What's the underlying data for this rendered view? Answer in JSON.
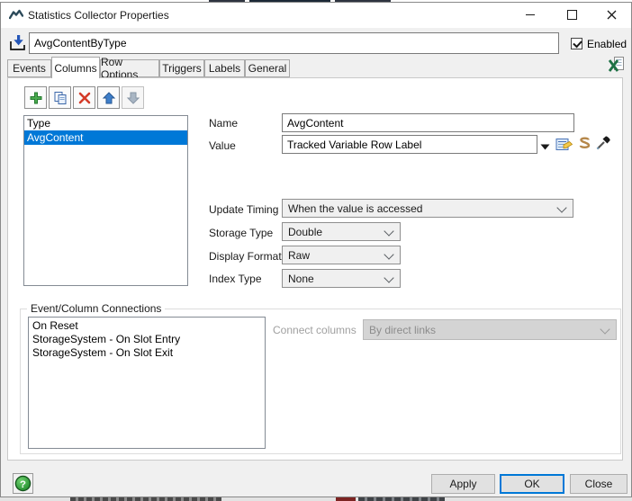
{
  "window": {
    "title": "Statistics Collector Properties",
    "controls": {
      "minimize": "minimize",
      "maximize": "maximize",
      "close": "close"
    }
  },
  "header": {
    "name_value": "AvgContentByType",
    "enabled_label": "Enabled"
  },
  "tabs": [
    {
      "label": "Events",
      "active": false
    },
    {
      "label": "Columns",
      "active": true
    },
    {
      "label": "Row Options",
      "active": false
    },
    {
      "label": "Triggers",
      "active": false
    },
    {
      "label": "Labels",
      "active": false
    },
    {
      "label": "General",
      "active": false
    }
  ],
  "toolbar": {
    "add": "add-column",
    "copy": "copy-column",
    "delete": "delete-column",
    "move_up": "move-up",
    "move_down": "move-down"
  },
  "columns_list": {
    "items": [
      {
        "label": "Type",
        "selected": false
      },
      {
        "label": "AvgContent",
        "selected": true
      }
    ]
  },
  "fields": {
    "name": {
      "label": "Name",
      "value": "AvgContent"
    },
    "value": {
      "label": "Value",
      "value": "Tracked Variable Row Label"
    },
    "update_timing": {
      "label": "Update Timing",
      "value": "When the value is accessed"
    },
    "storage_type": {
      "label": "Storage Type",
      "value": "Double"
    },
    "display_format": {
      "label": "Display Format",
      "value": "Raw"
    },
    "index_type": {
      "label": "Index Type",
      "value": "None"
    }
  },
  "connections": {
    "group_title": "Event/Column Connections",
    "items": [
      "On Reset",
      "StorageSystem - On Slot Entry",
      "StorageSystem - On Slot Exit"
    ],
    "connect_label": "Connect columns",
    "connect_value": "By direct links"
  },
  "footer": {
    "apply": "Apply",
    "ok": "OK",
    "close": "Close"
  },
  "icons": {
    "app": "flexsim-logo",
    "drop_object": "arrow-into-box",
    "excel": "excel-export",
    "value_dropdown": "dropdown-arrow",
    "properties": "edit-properties",
    "code": "scroll",
    "sampler": "eyedropper",
    "help_glyph": "?"
  },
  "colors": {
    "selection": "#0078d7",
    "ok_border": "#0078d7",
    "excel_green": "#1e7145",
    "add_green": "#3f9e47",
    "delete_red": "#d43b29",
    "help_green": "#2fa33a"
  }
}
